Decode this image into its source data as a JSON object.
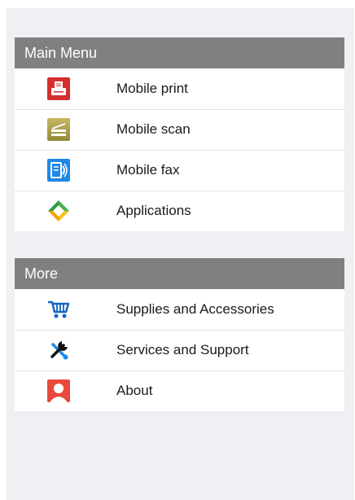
{
  "main_menu": {
    "title": "Main Menu",
    "items": [
      {
        "label": "Mobile print",
        "icon": "printer-icon"
      },
      {
        "label": "Mobile scan",
        "icon": "scanner-icon"
      },
      {
        "label": "Mobile fax",
        "icon": "fax-icon"
      },
      {
        "label": "Applications",
        "icon": "applications-icon"
      }
    ]
  },
  "more": {
    "title": "More",
    "items": [
      {
        "label": "Supplies and Accessories",
        "icon": "cart-icon"
      },
      {
        "label": "Services and Support",
        "icon": "tools-icon"
      },
      {
        "label": "About",
        "icon": "person-icon"
      }
    ]
  },
  "colors": {
    "section_header": "#808080",
    "background": "#efeff4",
    "print_icon": "#d32f2f",
    "scan_icon": "#b5a24a",
    "fax_icon": "#1e88e5",
    "cart_icon": "#1565c0",
    "about_icon": "#e8493b"
  }
}
